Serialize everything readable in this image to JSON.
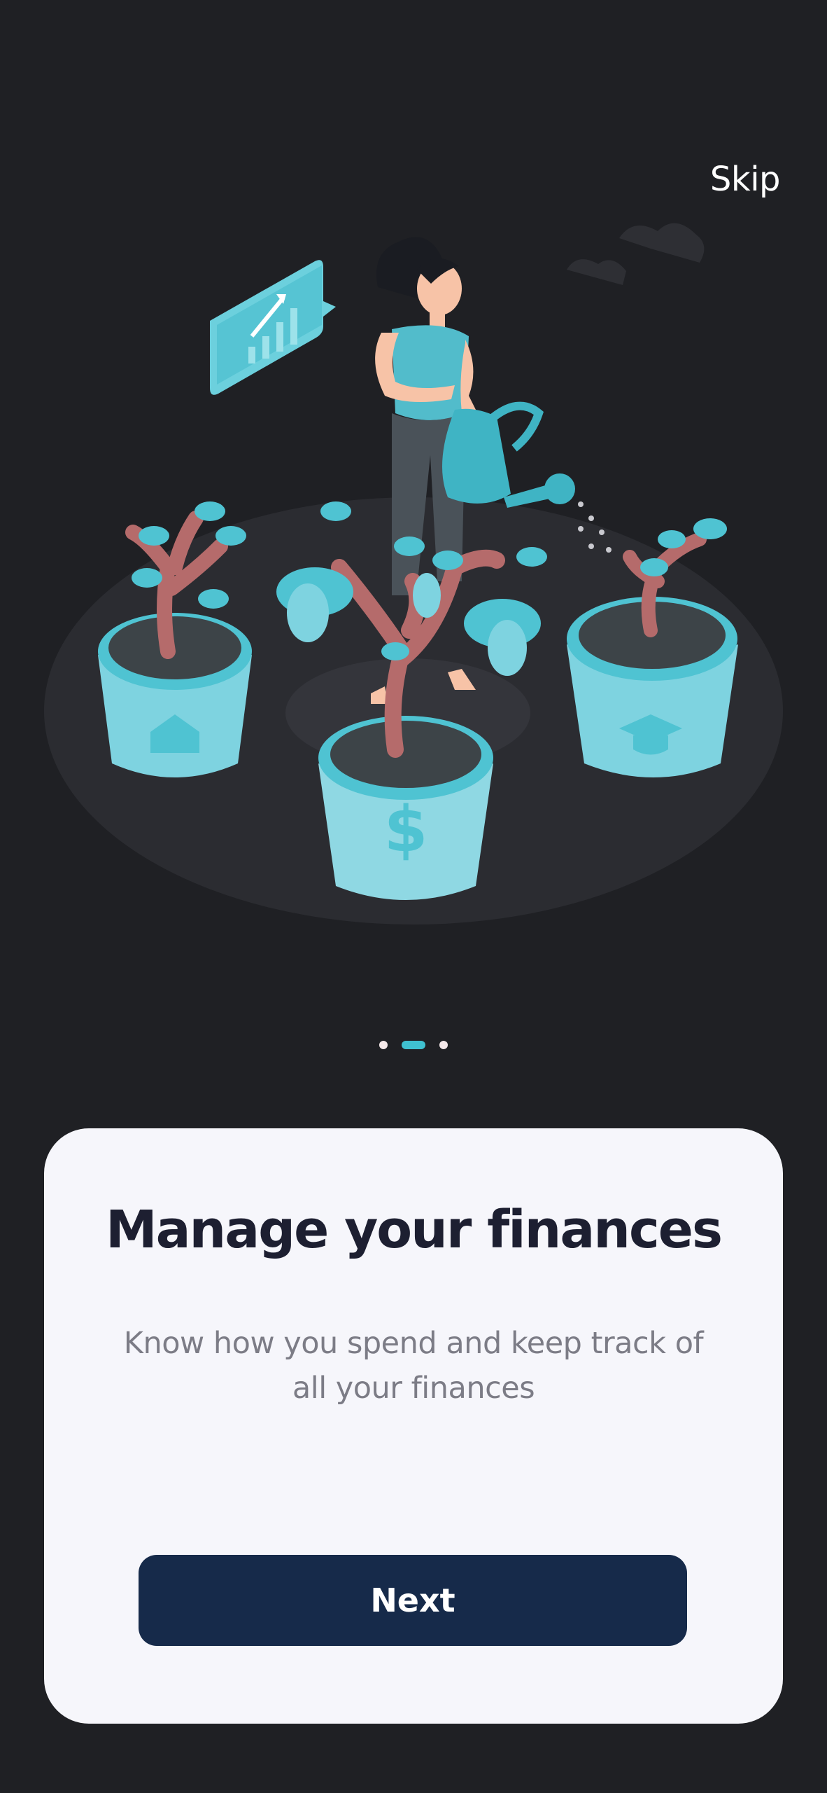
{
  "header": {
    "skip_label": "Skip"
  },
  "illustration": {
    "name": "woman-watering-money-plants",
    "colors": {
      "accent": "#3fc1d0",
      "pot": "#7ed3e0",
      "trunk": "#b56b6b",
      "ground": "#2b2c31"
    }
  },
  "pagination": {
    "total": 3,
    "active_index": 1
  },
  "card": {
    "title": "Manage your finances",
    "subtitle": "Know how you spend and keep track of all your finances",
    "next_label": "Next"
  },
  "colors": {
    "background": "#1f2024",
    "card": "#f6f6fb",
    "button": "#162a4a",
    "dot_active": "#3fc1d0"
  }
}
